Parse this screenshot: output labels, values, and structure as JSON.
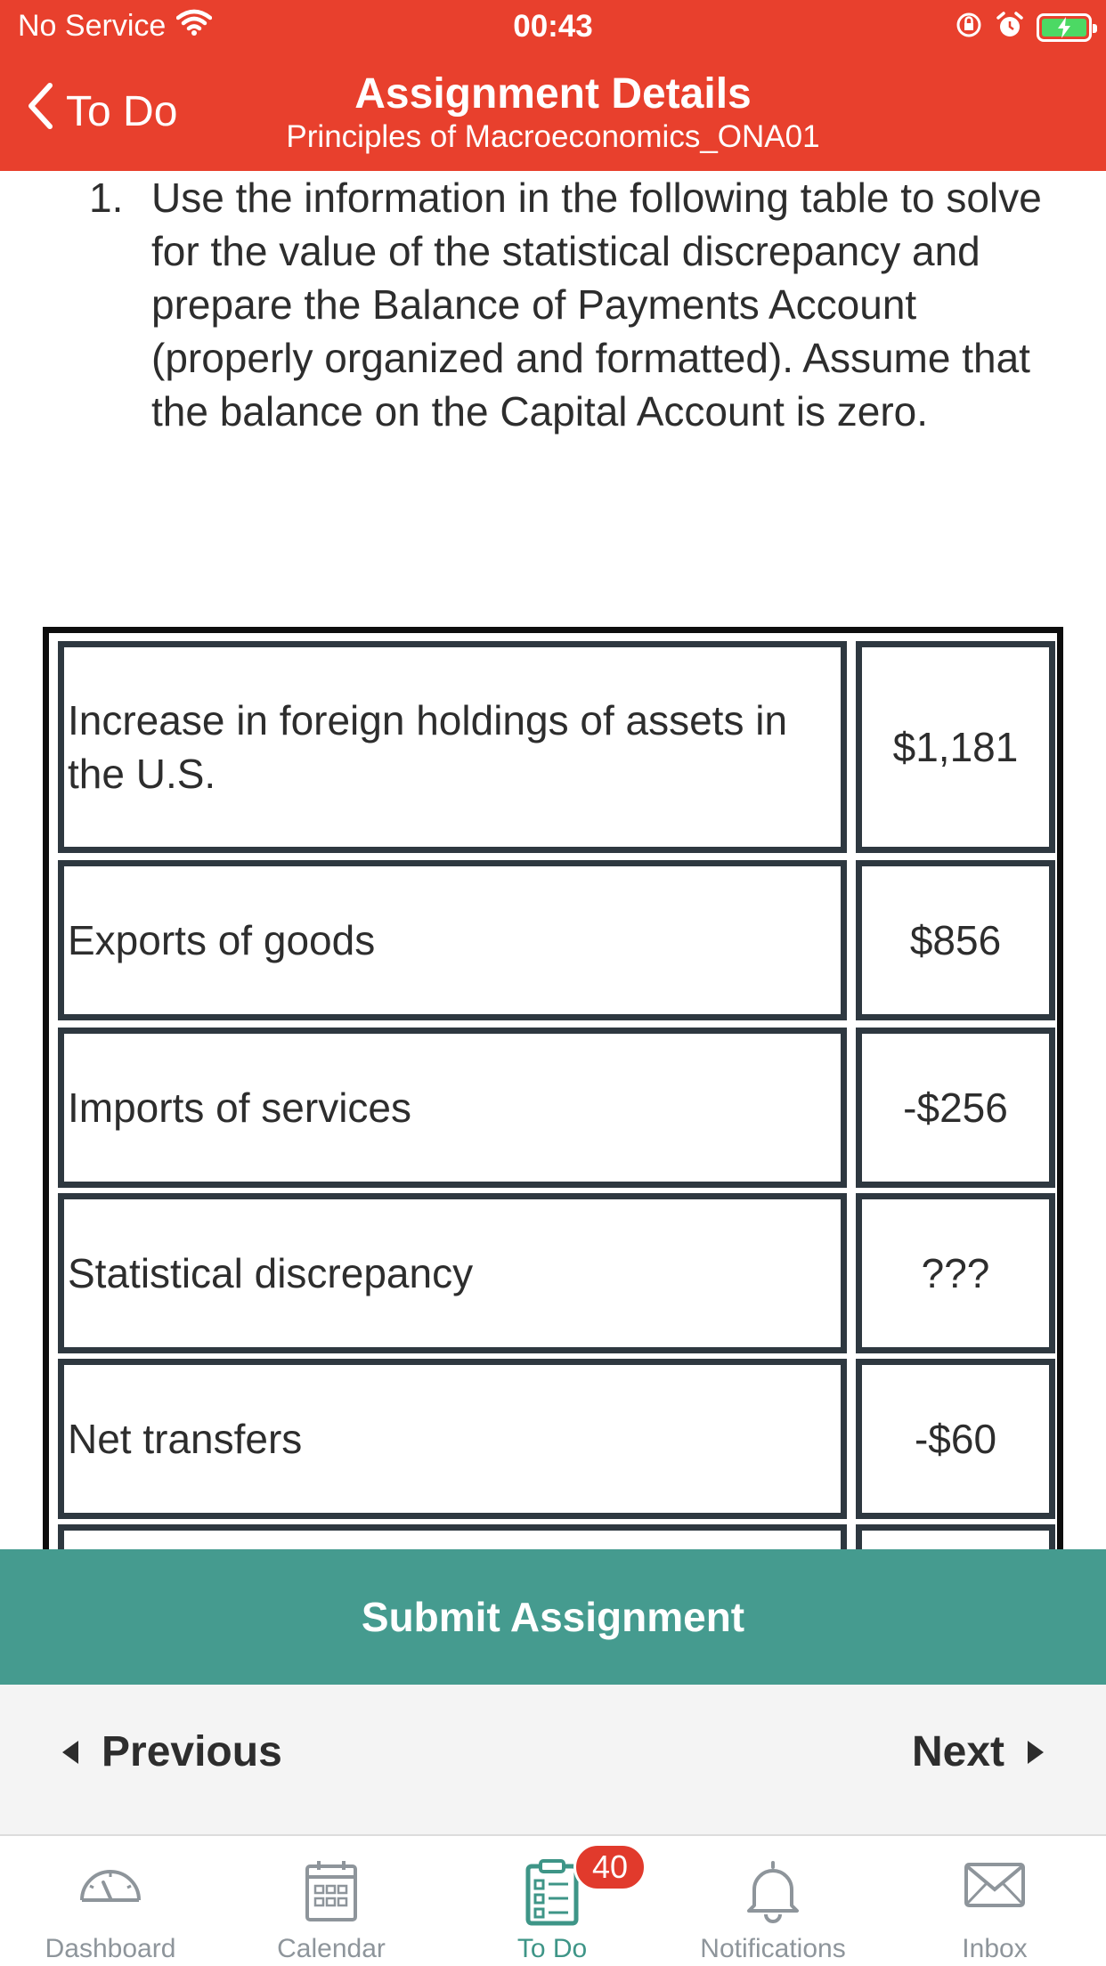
{
  "status_bar": {
    "carrier": "No Service",
    "time": "00:43"
  },
  "nav": {
    "back_label": "To Do",
    "title": "Assignment Details",
    "subtitle": "Principles of Macroeconomics_ONA01"
  },
  "question": {
    "number": "1.",
    "text": "Use the information in the following table to solve for the value of the statistical discrepancy and prepare the Balance of Payments Account (properly organized and formatted). Assume that the balance on the Capital Account is zero."
  },
  "table": {
    "rows": [
      {
        "label": "Increase in foreign holdings of assets in the U.S.",
        "value": "$1,181"
      },
      {
        "label": "Exports of goods",
        "value": "$856"
      },
      {
        "label": "Imports of services",
        "value": "-$256"
      },
      {
        "label": "Statistical discrepancy",
        "value": "???"
      },
      {
        "label": "Net transfers",
        "value": "-$60"
      },
      {
        "label": "",
        "value": ""
      }
    ]
  },
  "actions": {
    "submit_label": "Submit Assignment",
    "previous_label": "Previous",
    "next_label": "Next"
  },
  "tabbar": {
    "items": [
      {
        "label": "Dashboard",
        "icon": "dashboard-icon"
      },
      {
        "label": "Calendar",
        "icon": "calendar-icon"
      },
      {
        "label": "To Do",
        "icon": "todo-icon",
        "badge": "40",
        "active": true
      },
      {
        "label": "Notifications",
        "icon": "bell-icon"
      },
      {
        "label": "Inbox",
        "icon": "envelope-icon"
      }
    ]
  },
  "colors": {
    "header": "#e8402d",
    "submit": "#459b8f",
    "active_tab": "#3e9587",
    "badge": "#e13a2c"
  }
}
